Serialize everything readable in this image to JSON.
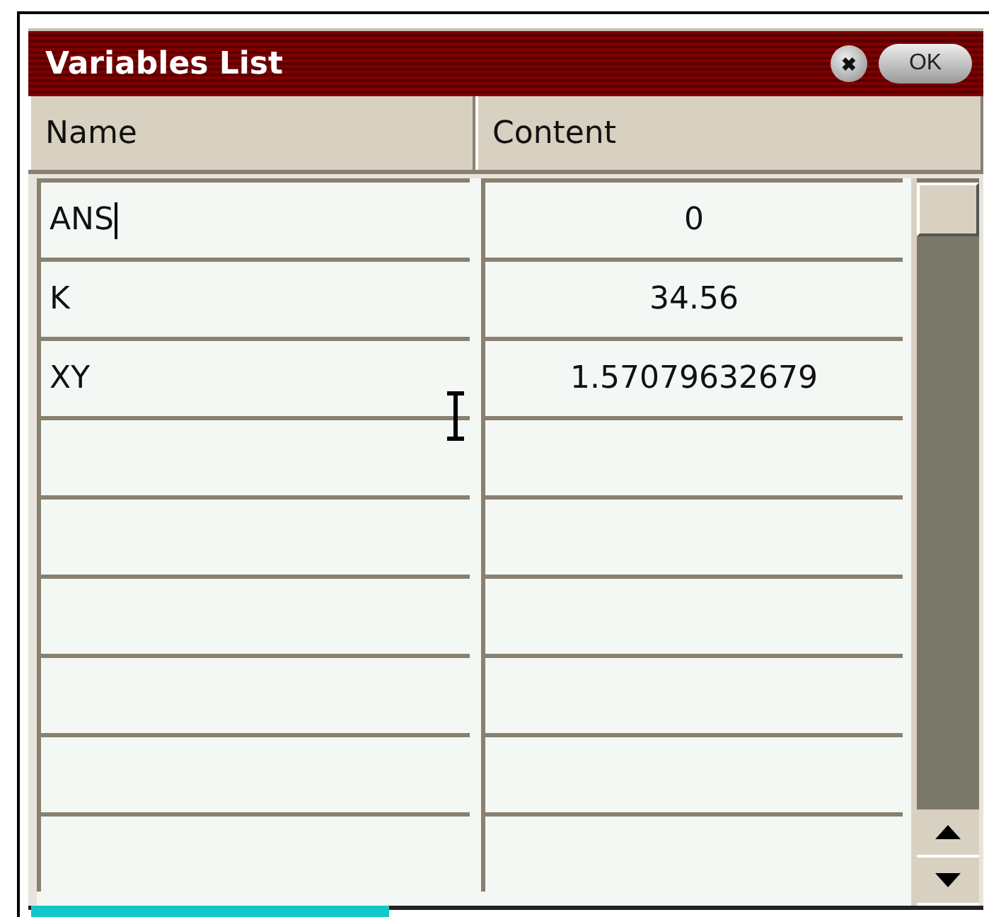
{
  "window": {
    "title": "Variables List",
    "buttons": [
      {
        "kind": "close",
        "label": "✖"
      },
      {
        "kind": "ok",
        "label": "OK"
      }
    ]
  },
  "table": {
    "columns": [
      "Name",
      "Content"
    ],
    "rows": [
      {
        "name": "ANS",
        "content": "0",
        "editing": true
      },
      {
        "name": "K",
        "content": "34.56",
        "editing": false
      },
      {
        "name": "XY",
        "content": "1.57079632679",
        "editing": false
      }
    ]
  }
}
